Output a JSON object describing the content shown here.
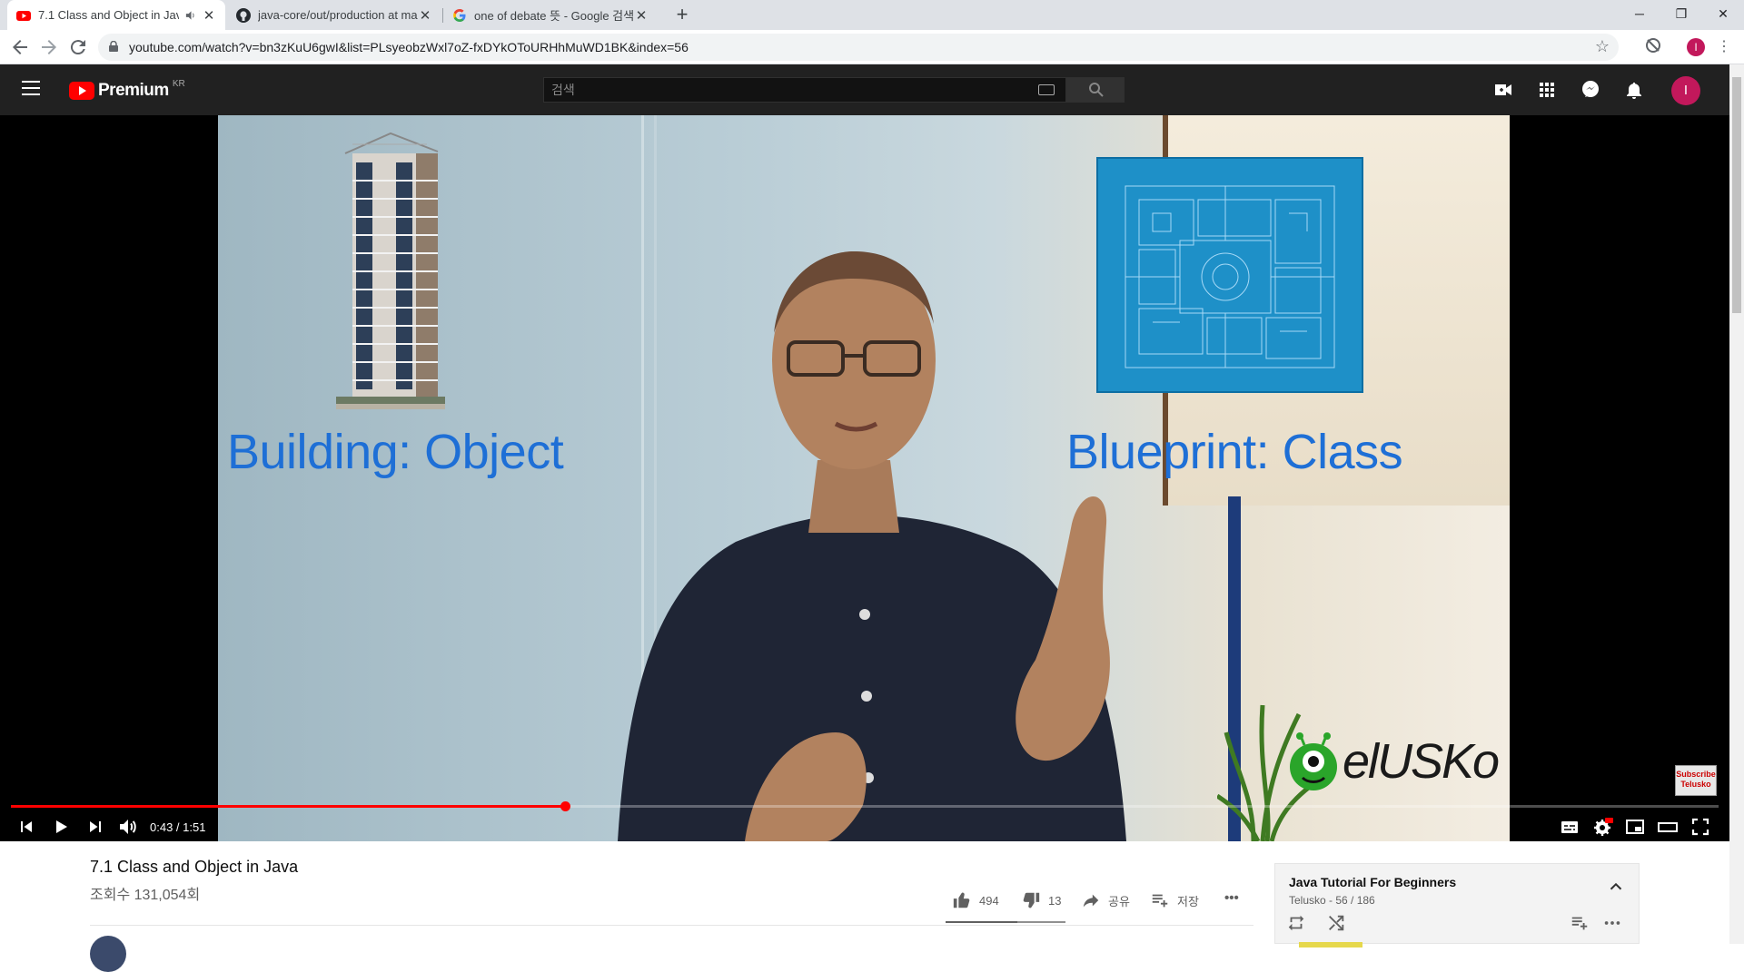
{
  "browser": {
    "tabs": [
      {
        "title": "7.1 Class and Object in Java",
        "active": true,
        "favicon": "youtube-icon"
      },
      {
        "title": "java-core/out/production at ma",
        "active": false,
        "favicon": "github-icon"
      },
      {
        "title": "one of debate 뜻 - Google 검색",
        "active": false,
        "favicon": "google-icon"
      }
    ],
    "new_tab": "+",
    "window_controls": {
      "minimize": "─",
      "restore": "❐",
      "close": "✕"
    },
    "url": "youtube.com/watch?v=bn3zKuU6gwI&list=PLsyeobzWxl7oZ-fxDYkOToURHhMuWD1BK&index=56",
    "profile_initial": "I"
  },
  "masthead": {
    "brand": "Premium",
    "region": "KR",
    "search_placeholder": "검색",
    "avatar_initial": "I"
  },
  "video": {
    "left_caption": "Building: Object",
    "right_caption": "Blueprint: Class",
    "watermark_tail": "elUSKo",
    "subscribe_badge": [
      "Subscribe",
      "Telusko"
    ],
    "time": "0:43 / 1:51",
    "progress": 0.3245
  },
  "details": {
    "title": "7.1 Class and Object in Java",
    "views": "조회수 131,054회",
    "likes": "494",
    "dislikes": "13",
    "share": "공유",
    "save": "저장",
    "more": "•••"
  },
  "playlist": {
    "title": "Java Tutorial For Beginners",
    "subtitle": "Telusko - 56 / 186"
  },
  "colors": {
    "youtube_red": "#ff0000",
    "masthead_bg": "#212121",
    "caption_blue": "#1e6fd6",
    "avatar": "#c2185b"
  }
}
